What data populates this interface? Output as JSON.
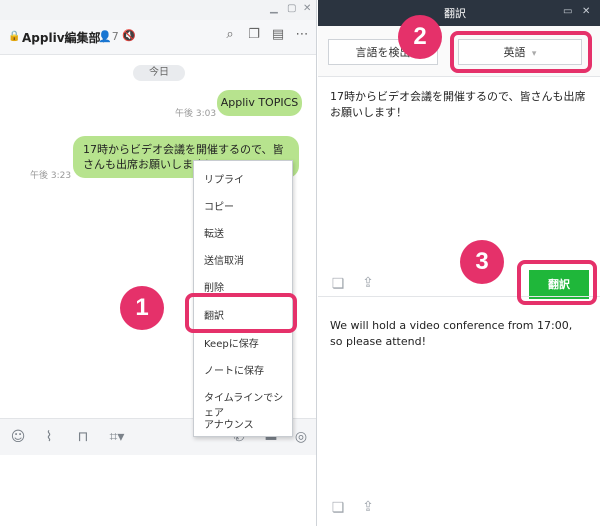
{
  "chat": {
    "room_name": "Appliv編集部！",
    "member_count": "7",
    "mute_icon": "speaker-muted",
    "header_icons": [
      "search-icon",
      "note-icon",
      "memo-icon",
      "more-icon"
    ],
    "date_label": "今日",
    "messages": [
      {
        "text": "Appliv TOPICS",
        "time": "午後 3:03"
      },
      {
        "text": "17時からビデオ会議を開催するので、皆さんも出席お願いします！",
        "time": "午後 3:23"
      }
    ],
    "context_menu": [
      "リプライ",
      "コピー",
      "転送",
      "送信取消",
      "削除",
      "翻訳",
      "Keepに保存",
      "ノートに保存",
      "タイムラインでシェア",
      "アナウンス"
    ],
    "bottom_icons": [
      "emoji-icon",
      "attach-icon",
      "bookmark-icon",
      "crop-icon",
      "phone-icon",
      "screen-icon",
      "camera-icon"
    ]
  },
  "translate": {
    "title": "翻訳",
    "source_lang": "言語を検出",
    "target_lang": "英語",
    "source_text": "17時からビデオ会議を開催するので、皆さんも出席お願いします！",
    "button": "翻訳",
    "output_text": "We will hold a video conference from 17:00, so please attend!"
  },
  "annotations": [
    "1",
    "2",
    "3"
  ],
  "colors": {
    "highlight": "#e5316a",
    "bubble": "#b7e38e",
    "translate_button": "#1fb73a",
    "titlebar": "#2b3440"
  }
}
